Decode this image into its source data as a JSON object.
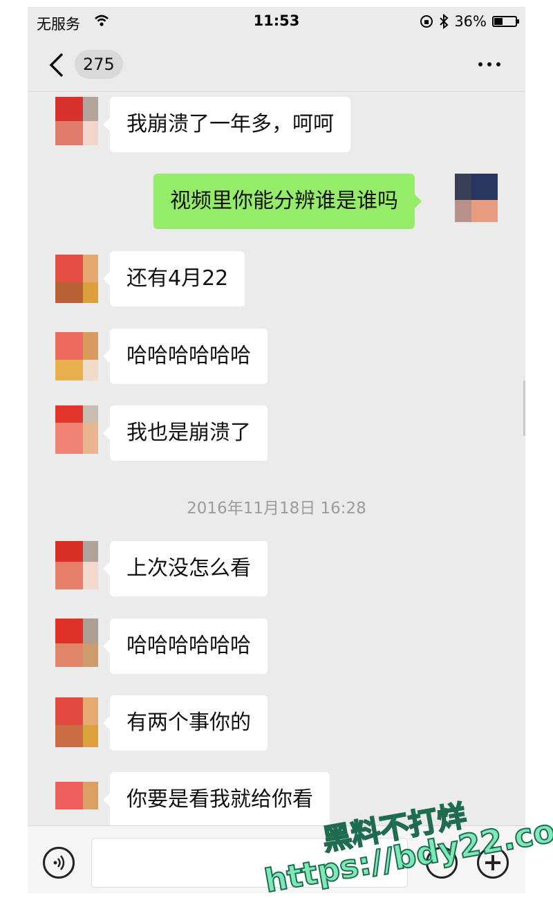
{
  "status_bar": {
    "carrier": "无服务",
    "time": "11:53",
    "battery": "36%"
  },
  "nav": {
    "unread_count": "275"
  },
  "messages": [
    {
      "text": "我崩溃了一年多，呵呵"
    },
    {
      "text": "视频里你能分辨谁是谁吗"
    },
    {
      "text": "还有4月22"
    },
    {
      "text": "哈哈哈哈哈哈"
    },
    {
      "text": "我也是崩溃了"
    },
    {
      "text": "上次没怎么看"
    },
    {
      "text": "哈哈哈哈哈哈"
    },
    {
      "text": "有两个事你的"
    },
    {
      "text": "你要是看我就给你看"
    }
  ],
  "timestamp": "2016年11月18日 16:28",
  "watermark": {
    "line1": "黑料不打烊",
    "line2": "https://bdy22.co"
  },
  "colors": {
    "background": "#ebebeb",
    "my_bubble": "#95ec69",
    "their_bubble": "#ffffff"
  }
}
